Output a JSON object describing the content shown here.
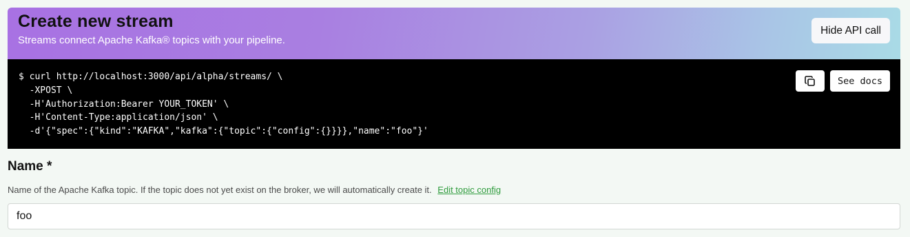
{
  "header": {
    "title": "Create new stream",
    "subtitle": "Streams connect Apache Kafka® topics with your pipeline.",
    "hide_api_label": "Hide API call"
  },
  "api_call": {
    "code": "$ curl http://localhost:3000/api/alpha/streams/ \\\n  -XPOST \\\n  -H'Authorization:Bearer YOUR_TOKEN' \\\n  -H'Content-Type:application/json' \\\n  -d'{\"spec\":{\"kind\":\"KAFKA\",\"kafka\":{\"topic\":{\"config\":{}}}},\"name\":\"foo\"}'",
    "copy_icon": "copy-icon",
    "docs_label": "See docs"
  },
  "name_field": {
    "label": "Name *",
    "help": "Name of the Apache Kafka topic. If the topic does not yet exist on the broker, we will automatically create it.",
    "edit_link": "Edit topic config",
    "value": "foo"
  }
}
